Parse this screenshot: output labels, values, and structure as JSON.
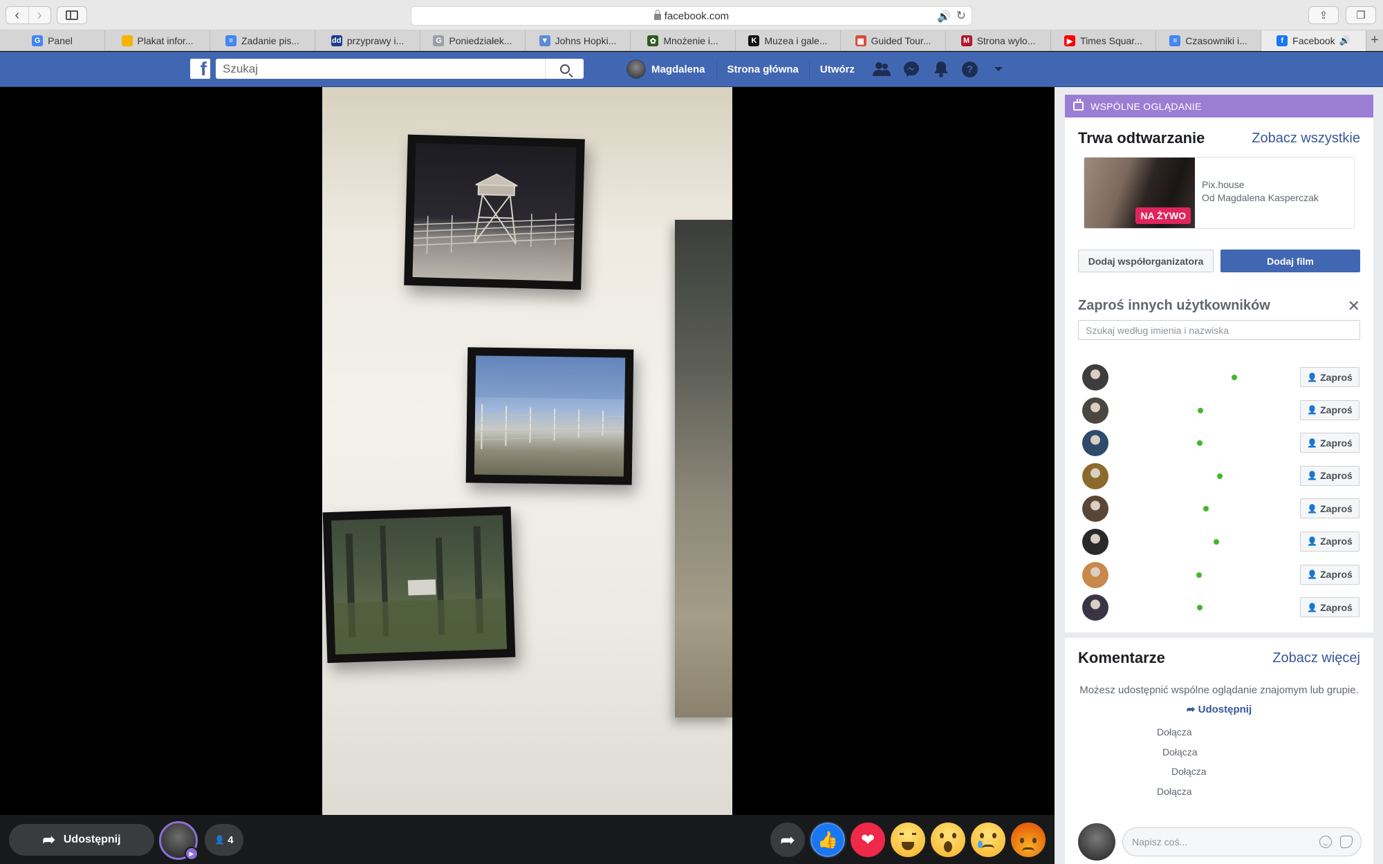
{
  "browser": {
    "url": "facebook.com",
    "tabs": [
      {
        "label": "Panel",
        "icon": "google-icon",
        "color": "#4285f4",
        "glyph": "G"
      },
      {
        "label": "Plakat infor...",
        "icon": "classroom-icon",
        "color": "#f4b400",
        "glyph": ""
      },
      {
        "label": "Zadanie pis...",
        "icon": "docs-icon",
        "color": "#4285f4",
        "glyph": "≡"
      },
      {
        "label": "przyprawy i...",
        "icon": "dd-icon",
        "color": "#1a3c8c",
        "glyph": "dd"
      },
      {
        "label": "Poniedziałek...",
        "icon": "gray-g-icon",
        "color": "#9aa0a6",
        "glyph": "G"
      },
      {
        "label": "Johns Hopki...",
        "icon": "shield-icon",
        "color": "#5b8dd6",
        "glyph": "▼"
      },
      {
        "label": "Mnożenie i...",
        "icon": "paw-icon",
        "color": "#2d5a1d",
        "glyph": "✿"
      },
      {
        "label": "Muzea i gale...",
        "icon": "k-icon",
        "color": "#111111",
        "glyph": "K"
      },
      {
        "label": "Guided Tour...",
        "icon": "museum-icon",
        "color": "#d94c3d",
        "glyph": "▦"
      },
      {
        "label": "Strona wylo...",
        "icon": "m-icon",
        "color": "#b0182e",
        "glyph": "M"
      },
      {
        "label": "Times Squar...",
        "icon": "youtube-icon",
        "color": "#ff0000",
        "glyph": "▶"
      },
      {
        "label": "Czasowniki i...",
        "icon": "docs-icon",
        "color": "#4285f4",
        "glyph": "≡"
      },
      {
        "label": "Facebook",
        "icon": "facebook-icon",
        "color": "#1877f2",
        "glyph": "f",
        "audio": "🔊",
        "active": true
      }
    ]
  },
  "fb": {
    "logo": "f",
    "search_placeholder": "Szukaj",
    "profile_name": "Magdalena",
    "nav": {
      "home": "Strona główna",
      "create": "Utwórz"
    }
  },
  "watch_party": {
    "header": "WSPÓLNE OGLĄDANIE",
    "now_playing": "Trwa odtwarzanie",
    "see_all": "Zobacz wszystkie",
    "video": {
      "title": "Pix.house",
      "owner": "Od Magdalena Kasperczak",
      "live_badge": "NA ŻYWO"
    },
    "add_cohost": "Dodaj współorganizatora",
    "add_video": "Dodaj film",
    "invite_title": "Zaproś innych użytkowników",
    "invite_placeholder": "Szukaj według imienia i nazwiska",
    "invite_label": "Zaproś",
    "friend_avatar_colors": [
      "#3d3d3d",
      "#4a4640",
      "#2f4a6b",
      "#8b6a2c",
      "#5a4636",
      "#2a2a2a",
      "#c9894c",
      "#3b3447"
    ]
  },
  "comments": {
    "title": "Komentarze",
    "see_more": "Zobacz więcej",
    "share_info": "Możesz udostępnić wspólne oglądanie znajomym lub grupie.",
    "share_link": "Udostępnij",
    "joins": [
      "Dołącza",
      "Dołącza",
      "Dołącza",
      "Dołącza"
    ],
    "input_placeholder": "Napisz coś..."
  },
  "bottom_bar": {
    "share": "Udostępnij",
    "viewers": "4"
  }
}
